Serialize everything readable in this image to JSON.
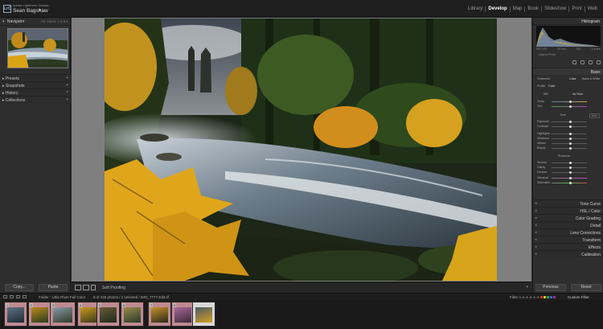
{
  "identity": {
    "product": "Adobe Lightroom Classic",
    "user": "Sean Bagshaw",
    "badge": "LrC"
  },
  "modules": [
    "Library",
    "Develop",
    "Map",
    "Book",
    "Slideshow",
    "Print",
    "Web"
  ],
  "active_module": "Develop",
  "left_panel": {
    "navigator_label": "Navigator",
    "zoom_options": "Fit  100%  1:1.53",
    "panels": [
      "Presets",
      "Snapshots",
      "History",
      "Collections"
    ],
    "copy_label": "Copy...",
    "paste_label": "Paste"
  },
  "toolbar": {
    "proofing_label": "Soft Proofing"
  },
  "right_panel": {
    "histogram_label": "Histogram",
    "hist_values": [
      "ISO 100",
      "24 mm",
      "f/11",
      "1.6 sec"
    ],
    "original_photo": "Original Photo",
    "basic_label": "Basic",
    "treatment_label": "Treatment",
    "color_label": "Color",
    "bw_label": "Black & White",
    "profile_label": "Profile",
    "profile_value": "Color",
    "wb_label": "WB",
    "wb_value": "As Shot",
    "basic_rows": [
      "Temp",
      "Tint",
      "Tone",
      "Exposure",
      "Contrast",
      "Highlights",
      "Shadows",
      "Whites",
      "Blacks",
      "Presence",
      "Texture",
      "Clarity",
      "Dehaze",
      "Vibrance",
      "Saturation"
    ],
    "auto_label": "Auto",
    "sections": [
      "Tone Curve",
      "HSL / Color",
      "Color Grading",
      "Detail",
      "Lens Corrections",
      "Transform",
      "Effects",
      "Calibration"
    ],
    "previous_label": "Previous",
    "reset_label": "Reset"
  },
  "filmbar": {
    "folder_path": "Folder : Little River Fall Color",
    "count_text": "8 of 445 photos / 1 selected / IMG_7777-Edit.tif",
    "filter_label": "Filter :",
    "custom_filter": "Custom Filter"
  },
  "thumbnails": [
    {
      "num": "1"
    },
    {
      "num": "2"
    },
    {
      "num": "3"
    },
    {
      "num": "4"
    },
    {
      "num": "5"
    },
    {
      "num": "6"
    },
    {
      "num": "7"
    },
    {
      "num": "8"
    }
  ],
  "colors": {
    "app_bg": "#2a2a2a",
    "center_bg": "#7f7f7f",
    "selected_thumb": "#c08a91",
    "autumn_yellow": "#d9a316",
    "forest_green": "#2e4a1e",
    "river_blue": "#4a5d6e"
  }
}
